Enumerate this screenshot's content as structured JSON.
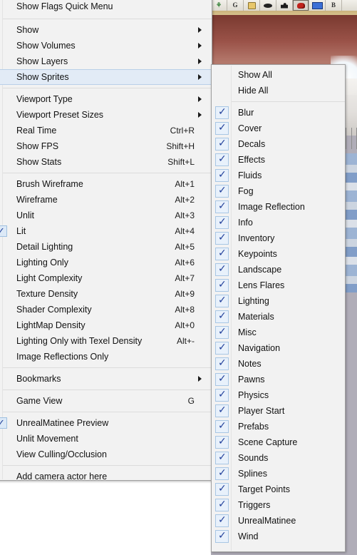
{
  "viewport": {
    "toolbar_icons": [
      {
        "name": "green-leaf-icon",
        "glyph": "⚘"
      },
      {
        "name": "g-letter-icon",
        "glyph": "G"
      },
      {
        "name": "lock-icon",
        "glyph": ""
      },
      {
        "name": "eye-icon",
        "glyph": ""
      },
      {
        "name": "camera-icon",
        "glyph": ""
      },
      {
        "name": "red-object-icon",
        "glyph": ""
      },
      {
        "name": "blue-rect-icon",
        "glyph": ""
      },
      {
        "name": "b-letter-icon",
        "glyph": "B"
      }
    ]
  },
  "main_menu": {
    "title": "Show Flags Quick Menu",
    "groups": [
      {
        "items": [
          {
            "label": "Show Flags Quick Menu",
            "accel": "",
            "arrow": false,
            "checked": false,
            "selected": false,
            "header": true
          }
        ]
      },
      {
        "items": [
          {
            "label": "Show",
            "accel": "",
            "arrow": true,
            "checked": false,
            "selected": false
          },
          {
            "label": "Show Volumes",
            "accel": "",
            "arrow": true,
            "checked": false,
            "selected": false
          },
          {
            "label": "Show Layers",
            "accel": "",
            "arrow": true,
            "checked": false,
            "selected": false
          },
          {
            "label": "Show Sprites",
            "accel": "",
            "arrow": true,
            "checked": false,
            "selected": true
          }
        ]
      },
      {
        "items": [
          {
            "label": "Viewport Type",
            "accel": "",
            "arrow": true,
            "checked": false,
            "selected": false
          },
          {
            "label": "Viewport Preset Sizes",
            "accel": "",
            "arrow": true,
            "checked": false,
            "selected": false
          },
          {
            "label": "Real Time",
            "accel": "Ctrl+R",
            "arrow": false,
            "checked": false,
            "selected": false
          },
          {
            "label": "Show FPS",
            "accel": "Shift+H",
            "arrow": false,
            "checked": false,
            "selected": false
          },
          {
            "label": "Show Stats",
            "accel": "Shift+L",
            "arrow": false,
            "checked": false,
            "selected": false
          }
        ]
      },
      {
        "items": [
          {
            "label": "Brush Wireframe",
            "accel": "Alt+1",
            "arrow": false,
            "checked": false,
            "selected": false
          },
          {
            "label": "Wireframe",
            "accel": "Alt+2",
            "arrow": false,
            "checked": false,
            "selected": false
          },
          {
            "label": "Unlit",
            "accel": "Alt+3",
            "arrow": false,
            "checked": false,
            "selected": false
          },
          {
            "label": "Lit",
            "accel": "Alt+4",
            "arrow": false,
            "checked": true,
            "selected": false
          },
          {
            "label": "Detail Lighting",
            "accel": "Alt+5",
            "arrow": false,
            "checked": false,
            "selected": false
          },
          {
            "label": "Lighting Only",
            "accel": "Alt+6",
            "arrow": false,
            "checked": false,
            "selected": false
          },
          {
            "label": "Light Complexity",
            "accel": "Alt+7",
            "arrow": false,
            "checked": false,
            "selected": false
          },
          {
            "label": "Texture Density",
            "accel": "Alt+9",
            "arrow": false,
            "checked": false,
            "selected": false
          },
          {
            "label": "Shader Complexity",
            "accel": "Alt+8",
            "arrow": false,
            "checked": false,
            "selected": false
          },
          {
            "label": "LightMap Density",
            "accel": "Alt+0",
            "arrow": false,
            "checked": false,
            "selected": false
          },
          {
            "label": "Lighting Only with Texel Density",
            "accel": "Alt+-",
            "arrow": false,
            "checked": false,
            "selected": false
          },
          {
            "label": "Image Reflections Only",
            "accel": "",
            "arrow": false,
            "checked": false,
            "selected": false
          }
        ]
      },
      {
        "items": [
          {
            "label": "Bookmarks",
            "accel": "",
            "arrow": true,
            "checked": false,
            "selected": false
          }
        ]
      },
      {
        "items": [
          {
            "label": "Game View",
            "accel": "G",
            "arrow": false,
            "checked": false,
            "selected": false
          }
        ]
      },
      {
        "items": [
          {
            "label": "UnrealMatinee Preview",
            "accel": "",
            "arrow": false,
            "checked": true,
            "selected": false
          },
          {
            "label": "Unlit Movement",
            "accel": "",
            "arrow": false,
            "checked": false,
            "selected": false
          },
          {
            "label": "View Culling/Occlusion",
            "accel": "",
            "arrow": false,
            "checked": false,
            "selected": false
          }
        ]
      },
      {
        "items": [
          {
            "label": "Add camera actor here",
            "accel": "",
            "arrow": false,
            "checked": false,
            "selected": false
          }
        ]
      }
    ]
  },
  "sub_menu": {
    "actions": [
      {
        "label": "Show All",
        "checked": false
      },
      {
        "label": "Hide All",
        "checked": false
      }
    ],
    "sprites": [
      {
        "label": "Blur",
        "checked": true
      },
      {
        "label": "Cover",
        "checked": true
      },
      {
        "label": "Decals",
        "checked": true
      },
      {
        "label": "Effects",
        "checked": true
      },
      {
        "label": "Fluids",
        "checked": true
      },
      {
        "label": "Fog",
        "checked": true
      },
      {
        "label": "Image Reflection",
        "checked": true
      },
      {
        "label": "Info",
        "checked": true
      },
      {
        "label": "Inventory",
        "checked": true
      },
      {
        "label": "Keypoints",
        "checked": true
      },
      {
        "label": "Landscape",
        "checked": true
      },
      {
        "label": "Lens Flares",
        "checked": true
      },
      {
        "label": "Lighting",
        "checked": true
      },
      {
        "label": "Materials",
        "checked": true
      },
      {
        "label": "Misc",
        "checked": true
      },
      {
        "label": "Navigation",
        "checked": true
      },
      {
        "label": "Notes",
        "checked": true
      },
      {
        "label": "Pawns",
        "checked": true
      },
      {
        "label": "Physics",
        "checked": true
      },
      {
        "label": "Player Start",
        "checked": true
      },
      {
        "label": "Prefabs",
        "checked": true
      },
      {
        "label": "Scene Capture",
        "checked": true
      },
      {
        "label": "Sounds",
        "checked": true
      },
      {
        "label": "Splines",
        "checked": true
      },
      {
        "label": "Target Points",
        "checked": true
      },
      {
        "label": "Triggers",
        "checked": true
      },
      {
        "label": "UnrealMatinee",
        "checked": true
      },
      {
        "label": "Wind",
        "checked": true
      }
    ]
  },
  "colors": {
    "menu_bg": "#f2f2f2",
    "menu_border": "#a0a0a0",
    "highlight_bg": "#e2ebf6",
    "highlight_border": "#b9cfe8",
    "check_blue": "#22409b",
    "checkbox_bg": "#e8f1fb",
    "desktop_gray": "#b0adb8"
  }
}
